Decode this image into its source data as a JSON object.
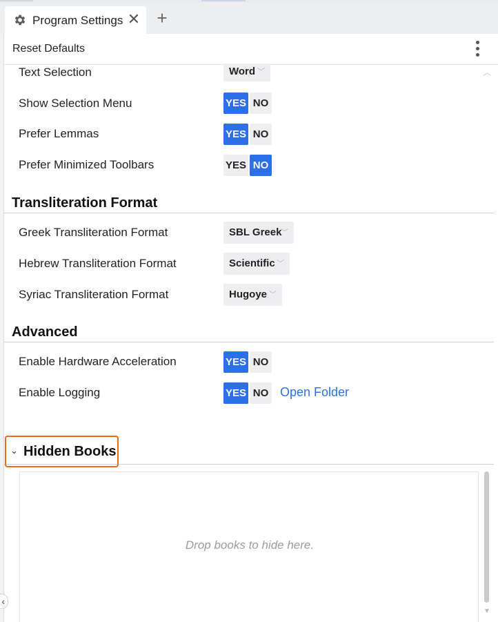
{
  "tab": {
    "icon": "gear-icon",
    "title": "Program Settings",
    "close_glyph": "✕",
    "new_tab_glyph": "+"
  },
  "toolbar": {
    "reset_label": "Reset Defaults",
    "menu_icon": "kebab-menu-icon"
  },
  "general": {
    "text_selection": {
      "label": "Text Selection",
      "value": "Word"
    },
    "show_selection_menu": {
      "label": "Show Selection Menu",
      "yes": "YES",
      "no": "NO",
      "selected": "YES"
    },
    "prefer_lemmas": {
      "label": "Prefer Lemmas",
      "yes": "YES",
      "no": "NO",
      "selected": "YES"
    },
    "prefer_minimized_toolbars": {
      "label": "Prefer Minimized Toolbars",
      "yes": "YES",
      "no": "NO",
      "selected": "NO"
    }
  },
  "transliteration": {
    "title": "Transliteration Format",
    "greek": {
      "label": "Greek Transliteration Format",
      "value": "SBL Greek"
    },
    "hebrew": {
      "label": "Hebrew Transliteration Format",
      "value": "Scientific"
    },
    "syriac": {
      "label": "Syriac Transliteration Format",
      "value": "Hugoye"
    }
  },
  "advanced": {
    "title": "Advanced",
    "hardware_acceleration": {
      "label": "Enable Hardware Acceleration",
      "yes": "YES",
      "no": "NO",
      "selected": "YES"
    },
    "logging": {
      "label": "Enable Logging",
      "yes": "YES",
      "no": "NO",
      "selected": "YES",
      "link": "Open Folder"
    }
  },
  "hidden_books": {
    "title": "Hidden Books",
    "placeholder": "Drop books to hide here."
  },
  "colors": {
    "accent": "#2b70e8",
    "highlight_border": "#ea6a1a"
  }
}
